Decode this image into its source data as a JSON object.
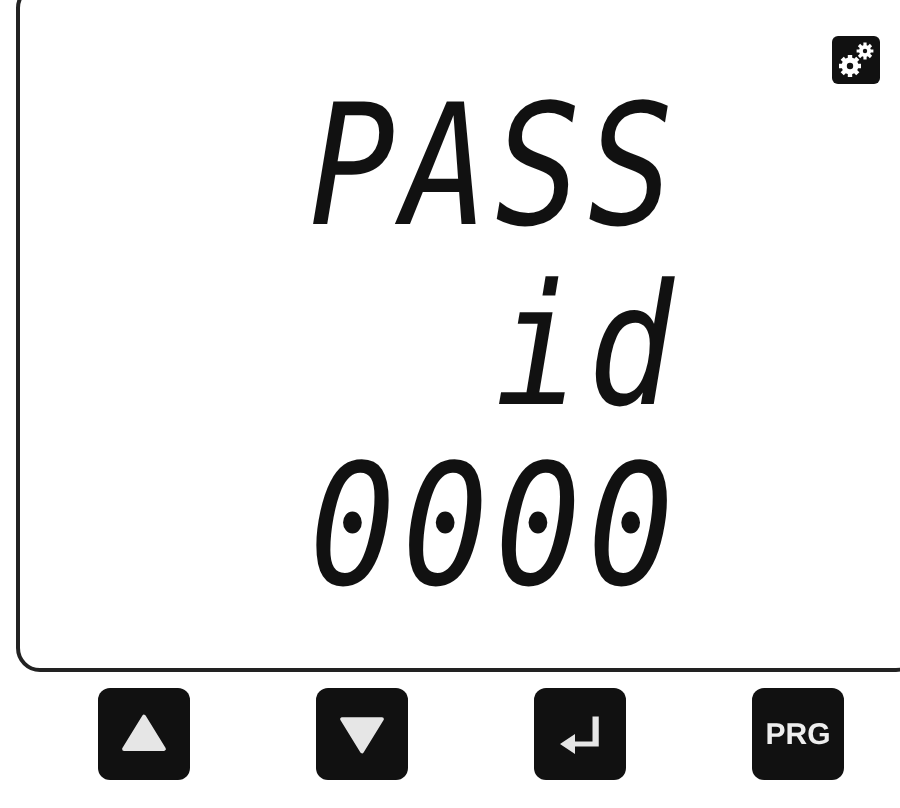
{
  "display": {
    "lines": [
      "PASS",
      "id",
      "0000"
    ],
    "settings_indicator": true
  },
  "buttons": [
    {
      "kind": "up"
    },
    {
      "kind": "down"
    },
    {
      "kind": "enter"
    },
    {
      "kind": "label",
      "label": "PRG"
    }
  ]
}
